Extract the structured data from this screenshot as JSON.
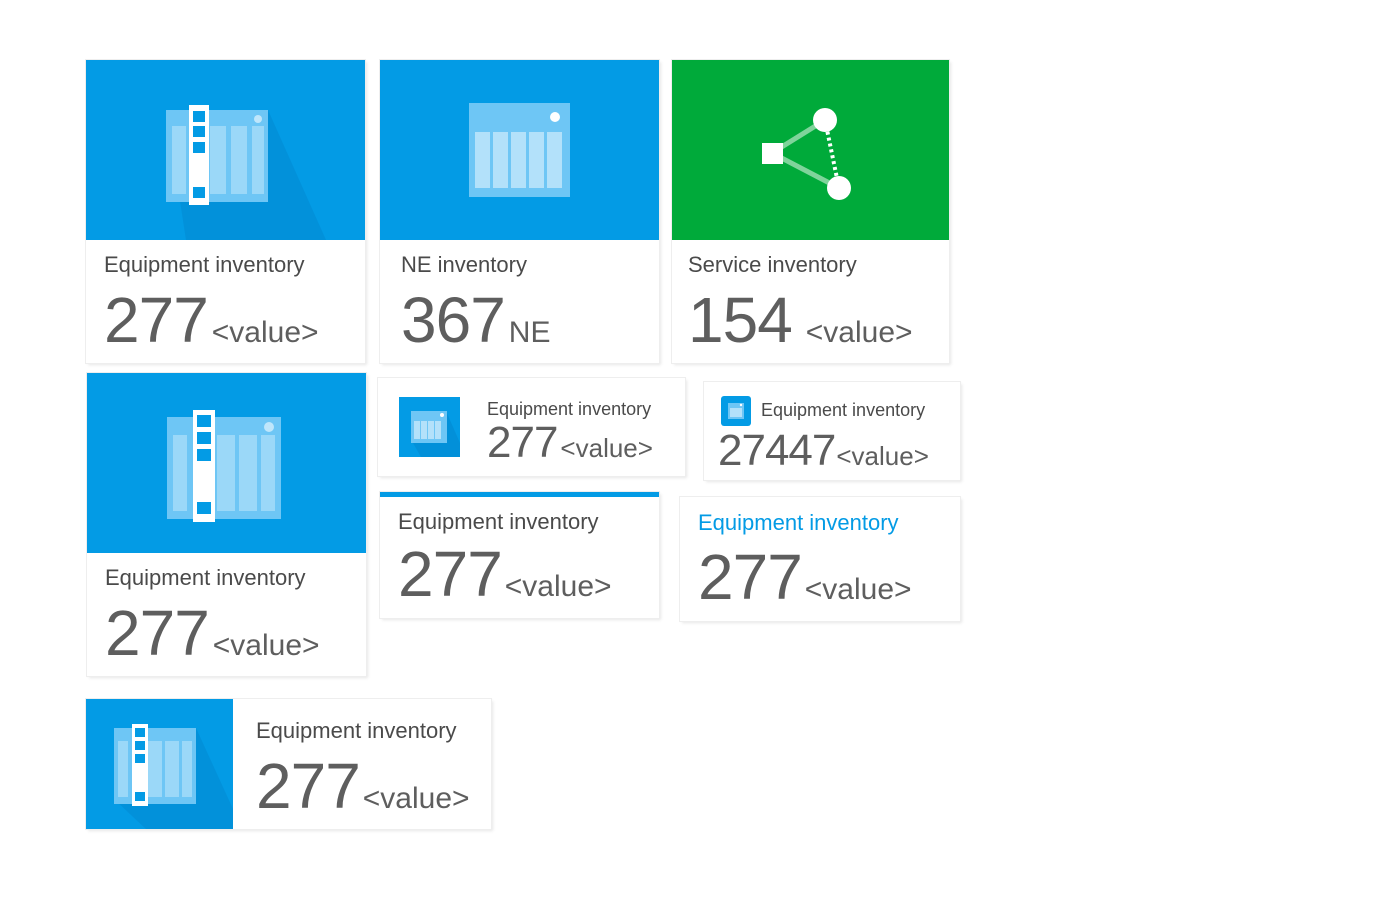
{
  "colors": {
    "primary_blue": "#039be5",
    "service_green": "#00aa3a",
    "text_gray": "#5e5e5e"
  },
  "cards": [
    {
      "id": "card-1",
      "title": "Equipment inventory",
      "value": "277",
      "unit": "<value>",
      "icon": "equipment-rack-icon",
      "banner": "blue"
    },
    {
      "id": "card-2",
      "title": "NE inventory",
      "value": "367",
      "unit": "NE",
      "icon": "ne-chassis-icon",
      "banner": "blue"
    },
    {
      "id": "card-3",
      "title": "Service inventory",
      "value": "154",
      "unit": "<value>",
      "icon": "service-topology-icon",
      "banner": "green"
    },
    {
      "id": "card-4",
      "title": "Equipment inventory",
      "value": "277",
      "unit": "<value>",
      "icon": "equipment-rack-icon",
      "banner": "blue"
    },
    {
      "id": "card-5",
      "title": "Equipment inventory",
      "value": "277",
      "unit": "<value>",
      "icon": "ne-chassis-icon"
    },
    {
      "id": "card-6",
      "title": "Equipment inventory",
      "value": "27447",
      "unit": "<value>",
      "icon": "ne-chassis-icon"
    },
    {
      "id": "card-7",
      "title": "Equipment inventory",
      "value": "277",
      "unit": "<value>",
      "style": "top-accent-bar"
    },
    {
      "id": "card-8",
      "title": "Equipment inventory",
      "value": "277",
      "unit": "<value>",
      "style": "accent-title"
    },
    {
      "id": "card-9",
      "title": "Equipment inventory",
      "value": "277",
      "unit": "<value>",
      "icon": "equipment-rack-icon",
      "banner": "blue"
    }
  ]
}
